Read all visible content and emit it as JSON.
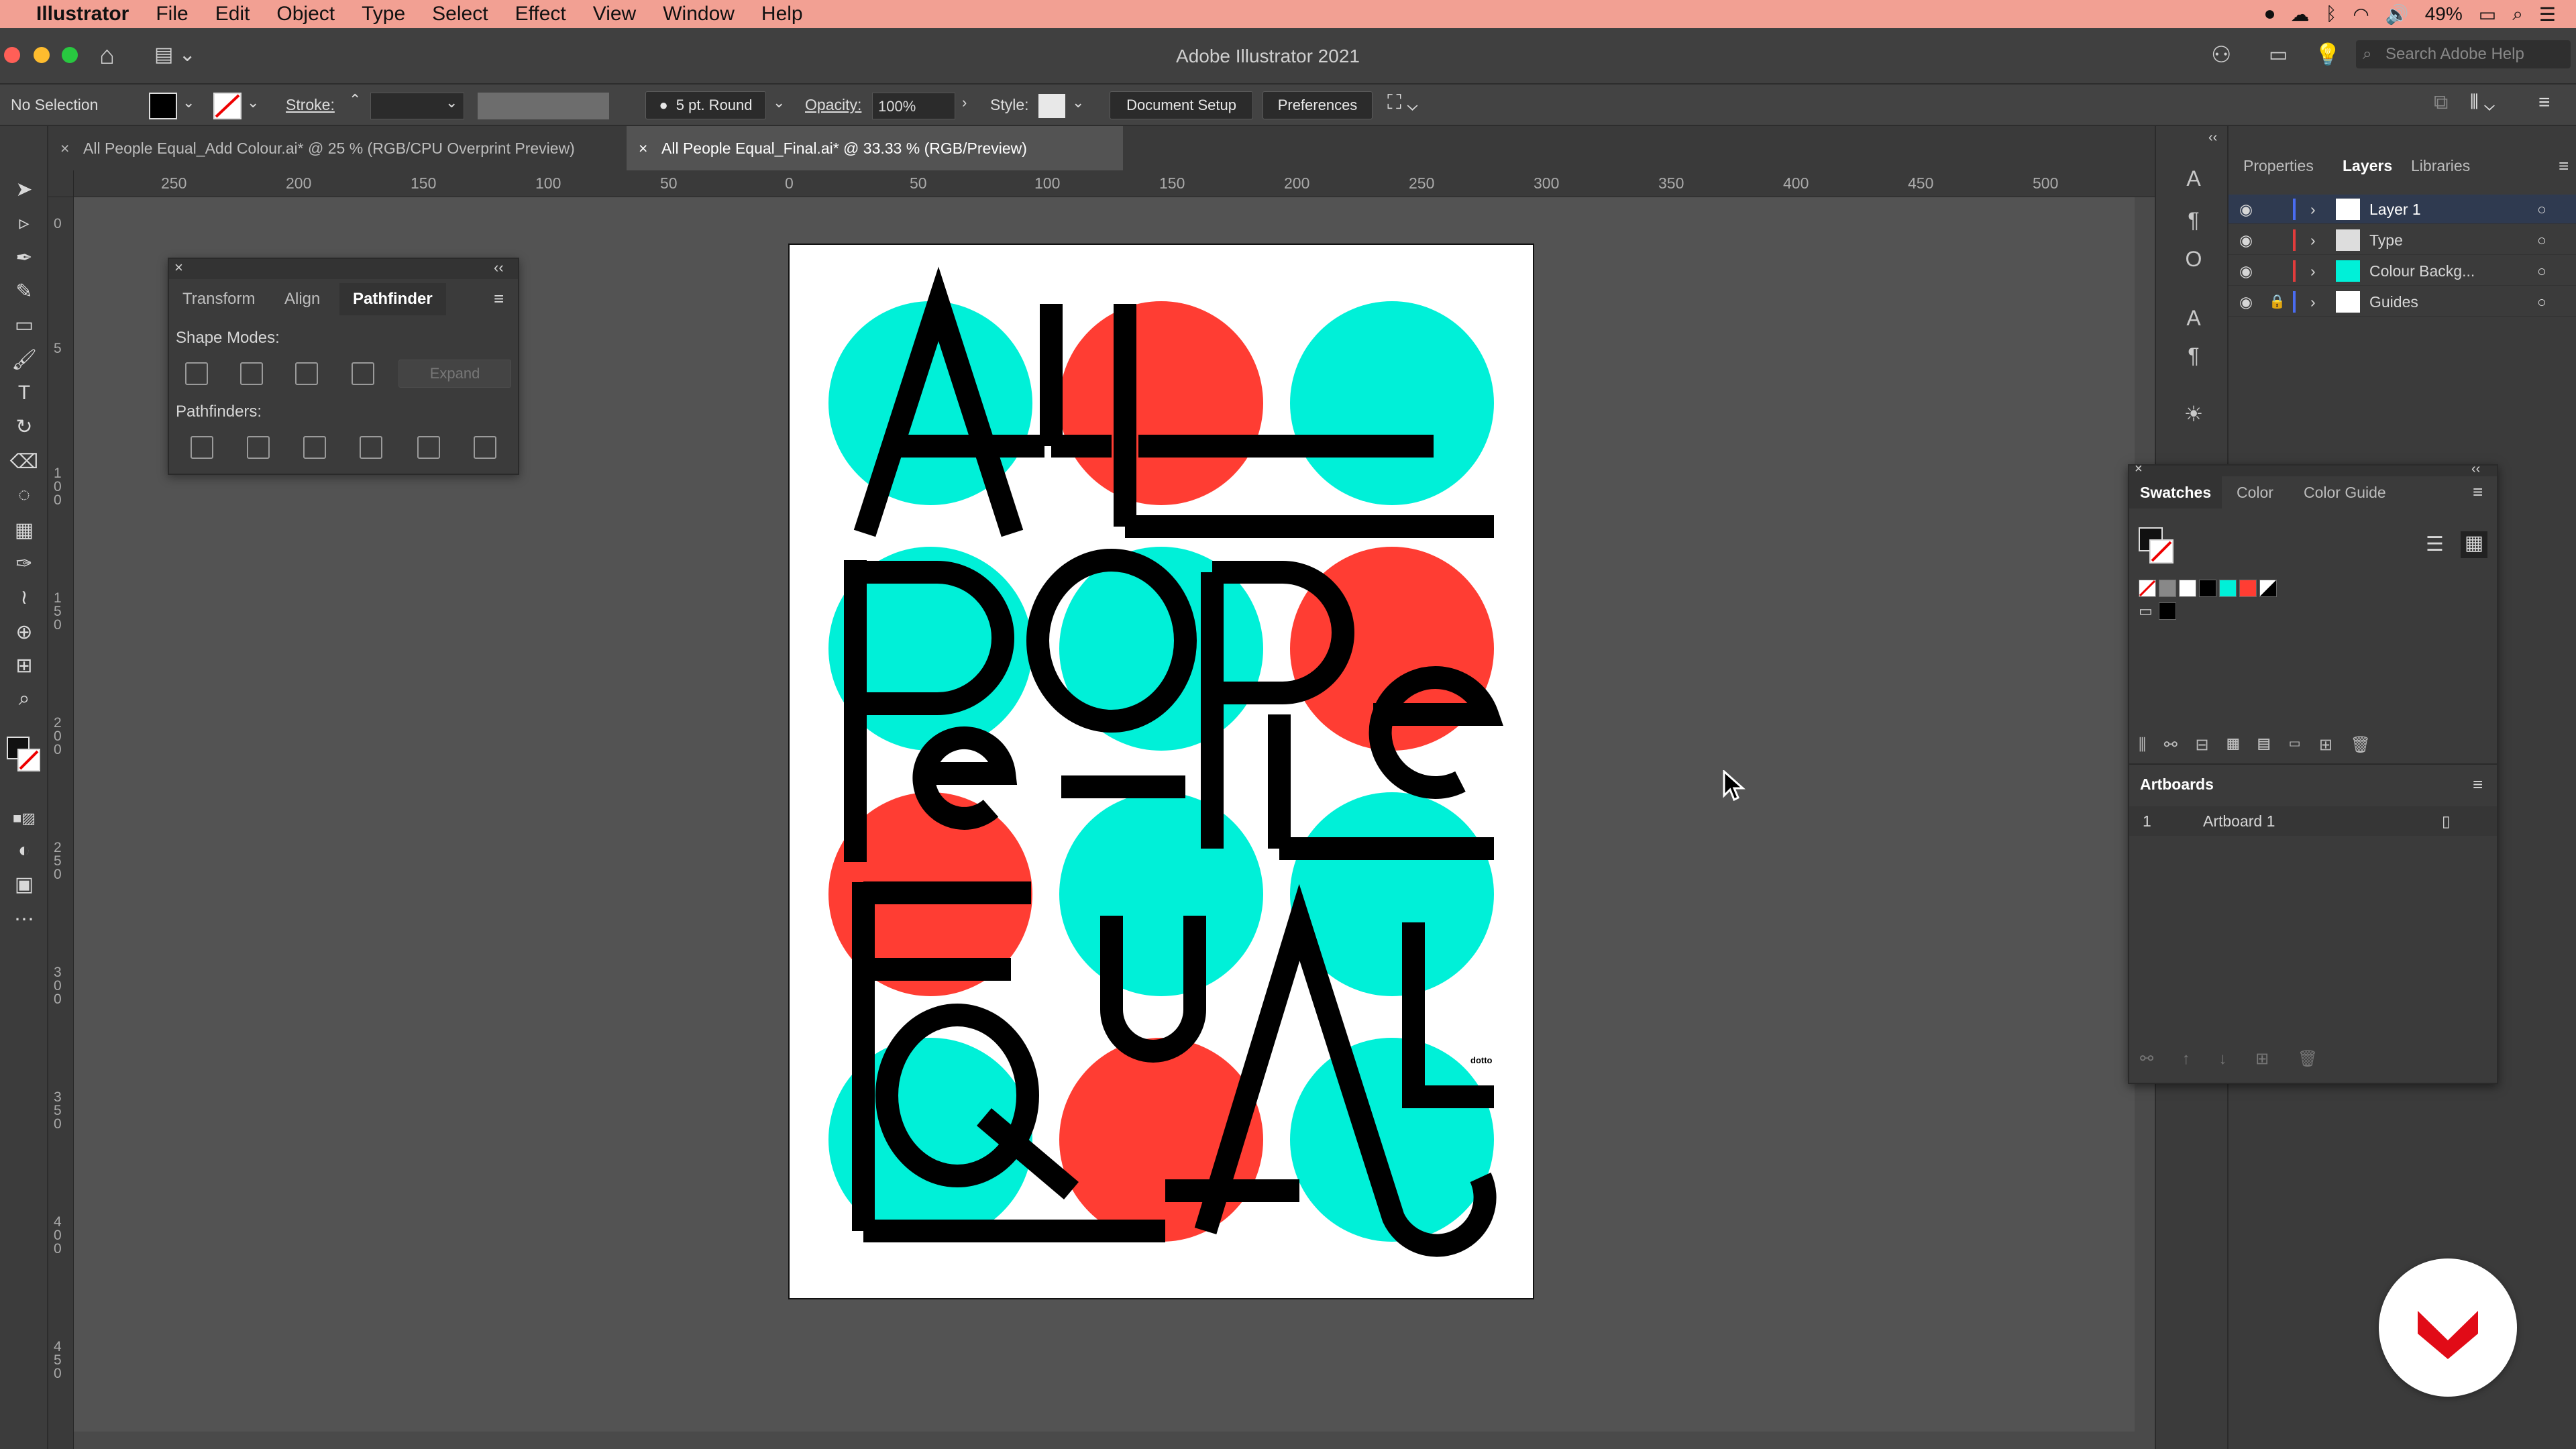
{
  "menubar": {
    "app_name": "Illustrator",
    "items": [
      "File",
      "Edit",
      "Object",
      "Type",
      "Select",
      "Effect",
      "View",
      "Window",
      "Help"
    ],
    "battery": "49%"
  },
  "window": {
    "title": "Adobe Illustrator 2021",
    "search_placeholder": "Search Adobe Help"
  },
  "control_bar": {
    "selection": "No Selection",
    "stroke_label": "Stroke:",
    "brush": "5 pt. Round",
    "opacity_label": "Opacity:",
    "opacity_value": "100%",
    "style_label": "Style:",
    "document_setup": "Document Setup",
    "preferences": "Preferences"
  },
  "tabs": [
    {
      "label": "All People Equal_Add Colour.ai* @ 25 % (RGB/CPU Overprint Preview)"
    },
    {
      "label": "All People Equal_Final.ai* @ 33.33 % (RGB/Preview)"
    }
  ],
  "rulers": {
    "h_ticks": [
      "250",
      "200",
      "150",
      "100",
      "50",
      "0",
      "50",
      "100",
      "150",
      "200",
      "250",
      "300",
      "350",
      "400",
      "450",
      "500"
    ],
    "v_ticks": [
      "0",
      "5",
      "1\n0\n0",
      "1\n5\n0",
      "2\n0\n0",
      "2\n5\n0",
      "3\n0\n0",
      "3\n5\n0",
      "4\n0\n0",
      "4\n5\n0"
    ]
  },
  "pathfinder_panel": {
    "tabs": [
      "Transform",
      "Align",
      "Pathfinder"
    ],
    "shape_modes_label": "Shape Modes:",
    "expand": "Expand",
    "pathfinders_label": "Pathfinders:"
  },
  "right_panel": {
    "tabs": [
      "Properties",
      "Layers",
      "Libraries"
    ],
    "layers": [
      {
        "name": "Layer 1",
        "color": "#4a6cf0",
        "locked": false
      },
      {
        "name": "Type",
        "color": "#e23c3c",
        "locked": false
      },
      {
        "name": "Colour Backg...",
        "color": "#e23c3c",
        "locked": false
      },
      {
        "name": "Guides",
        "color": "#4a6cf0",
        "locked": true
      }
    ]
  },
  "swatches_panel": {
    "tabs": [
      "Swatches",
      "Color",
      "Color Guide"
    ],
    "swatch_colors": [
      "#ffffff",
      "#000000",
      "#00f0d8",
      "#ff3d33"
    ]
  },
  "artboards_panel": {
    "title": "Artboards",
    "items": [
      {
        "index": "1",
        "name": "Artboard 1"
      }
    ]
  },
  "poster": {
    "lines": [
      "ALL",
      "POPeLe",
      "EuAL",
      "EQAL"
    ],
    "credit": "dotto",
    "colors": {
      "cyan": "#00f0d8",
      "red": "#ff3d33",
      "black": "#000000"
    }
  }
}
